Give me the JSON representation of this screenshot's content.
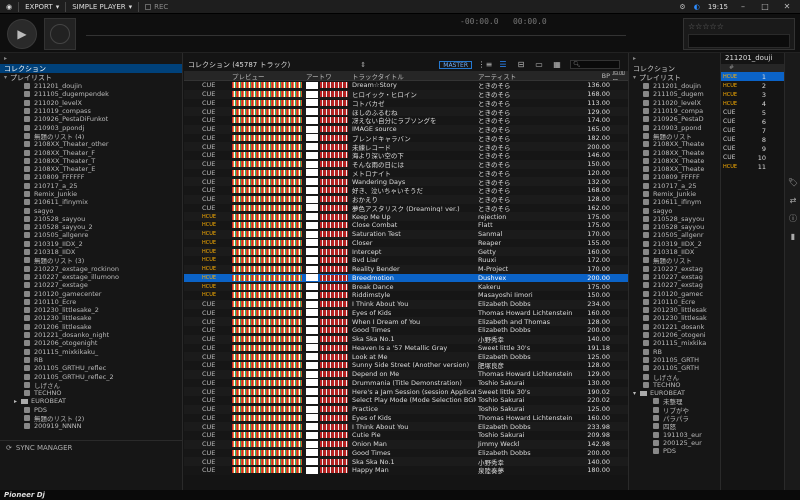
{
  "topbar": {
    "export_label": "EXPORT",
    "player_label": "SIMPLE PLAYER",
    "rec_label": "REC",
    "clock": "19:15"
  },
  "player": {
    "time_elapsed": "-00:00.0",
    "time_remain": "00:00.0",
    "stars": "☆☆☆☆☆"
  },
  "left": {
    "collection_label": "コレクション",
    "playlist_label": "プレイリスト",
    "items": [
      "211201_doujin",
      "211105_dugempendek",
      "211020_levelX",
      "211019_compass",
      "210926_PestaDiFunkot",
      "210903_ppondj",
      "無題のリスト (4)",
      "2108XX_Theater_other",
      "2108XX_Theater_F",
      "2108XX_Theater_T",
      "2108XX_Theater_E",
      "210809_FFFFFF",
      "210717_a_25",
      "Remix_Junkie",
      "210611_ifinymix",
      "sagyo",
      "210528_sayyou",
      "210528_sayyou_2",
      "210505_allgenre",
      "210319_IIDX_2",
      "210318_IIDX",
      "無題のリスト (3)",
      "210227_exstage_rockinon",
      "210227_exstage_illumono",
      "210227_exstage",
      "210120_gamecenter",
      "210110_Ecre",
      "201230_littlesake_2",
      "201230_littlesake",
      "201206_littlesake",
      "201221_dosanko_night",
      "201206_otogenight",
      "201115_mixkikaku_",
      "RB",
      "201105_GRTHU_reflec",
      "201105_GRTHU_reflec_2",
      "しげさん",
      "TECHNO",
      "EUROBEAT",
      "PDS",
      "無題のリスト (2)",
      "200919_NNNN"
    ],
    "sync_label": "SYNC MANAGER"
  },
  "main": {
    "header_title": "コレクション (45787 トラック)",
    "master_label": "MASTER",
    "columns": {
      "preview": "プレビュー",
      "artwork": "アートワ",
      "title": "トラックタイトル",
      "artist": "アーティスト",
      "bpm": "BP",
      "added": "追加日"
    }
  },
  "rows": [
    [
      "CUE",
      "Dream☆Story",
      "ときのそら",
      "136.00"
    ],
    [
      "CUE",
      "ヒロイック・ヒロイン",
      "ときのそら",
      "168.00"
    ],
    [
      "CUE",
      "コトバカゼ",
      "ときのそら",
      "113.00"
    ],
    [
      "CUE",
      "ほしのふるむね",
      "ときのそら",
      "129.00"
    ],
    [
      "CUE",
      "冴えない自分にラブソングを",
      "ときのそら",
      "174.00"
    ],
    [
      "CUE",
      "IMAGE source",
      "ときのそら",
      "165.00"
    ],
    [
      "CUE",
      "ブレンドキャラバン",
      "ときのそら",
      "182.00"
    ],
    [
      "CUE",
      "未練レコード",
      "ときのそら",
      "200.00"
    ],
    [
      "CUE",
      "海より深い空の下",
      "ときのそら",
      "146.00"
    ],
    [
      "CUE",
      "そんな雨の日には",
      "ときのそら",
      "150.00"
    ],
    [
      "CUE",
      "メトロナイト",
      "ときのそら",
      "120.00"
    ],
    [
      "CUE",
      "Wandering Days",
      "ときのそら",
      "132.00"
    ],
    [
      "CUE",
      "好き、泣いちゃいそうだ",
      "ときのそら",
      "168.00"
    ],
    [
      "CUE",
      "おかえり",
      "ときのそら",
      "128.00"
    ],
    [
      "CUE",
      "夢色アスタリスク (Dreaming! ver.)",
      "ときのそら",
      "162.00"
    ],
    [
      "HCUE",
      "Keep Me Up",
      "rejection",
      "175.00"
    ],
    [
      "HCUE",
      "Close Combat",
      "Flatt",
      "175.00"
    ],
    [
      "HCUE",
      "Saturation Test",
      "Sanmal",
      "170.00"
    ],
    [
      "HCUE",
      "Closer",
      "Reaper",
      "155.00"
    ],
    [
      "HCUE",
      "Intercept",
      "Getty",
      "160.00"
    ],
    [
      "HCUE",
      "Bvd Liar",
      "Ruuxi",
      "172.00"
    ],
    [
      "HCUE",
      "Reality Bender",
      "M-Project",
      "170.00"
    ],
    [
      "HCUE",
      "Breedmotion",
      "Dushvex",
      "200.00"
    ],
    [
      "HCUE",
      "Break Dance",
      "Kakeru",
      "175.00"
    ],
    [
      "HCUE",
      "Riddimstyle",
      "Masayoshi Iimori",
      "150.00"
    ],
    [
      "CUE",
      "I Think About You",
      "Elizabeth Dobbs",
      "234.00"
    ],
    [
      "CUE",
      "Eyes of Kids",
      "Thomas Howard Lichtenstein",
      "160.00"
    ],
    [
      "CUE",
      "When I Dream of You",
      "Elizabeth and Thomas",
      "128.00"
    ],
    [
      "CUE",
      "Good Times",
      "Elizabeth Dobbs",
      "200.00"
    ],
    [
      "CUE",
      "Ska Ska No.1",
      "小野秀幸",
      "140.00"
    ],
    [
      "CUE",
      "Heaven Is a '57 Metallic Gray",
      "Sweet little 30's",
      "191.18"
    ],
    [
      "CUE",
      "Look at Me",
      "Elizabeth Dobbs",
      "125.00"
    ],
    [
      "CUE",
      "Sunny Side Street (Another version)",
      "肥塚良彦",
      "128.00"
    ],
    [
      "CUE",
      "Depend on Me",
      "Thomas Howard Lichtenstein",
      "129.00"
    ],
    [
      "CUE",
      "Drummania (Title Demonstration)",
      "Toshio Sakurai",
      "130.00"
    ],
    [
      "CUE",
      "Here's a Jam Session (session Application",
      "Sweet little 30's",
      "190.02"
    ],
    [
      "CUE",
      "Select Play Mode (Mode Selection BGM)",
      "Toshio Sakurai",
      "220.02"
    ],
    [
      "CUE",
      "Practice",
      "Toshio Sakurai",
      "125.00"
    ],
    [
      "CUE",
      "Eyes of Kids",
      "Thomas Howard Lichtenstein",
      "160.00"
    ],
    [
      "CUE",
      "I Think About You",
      "Elizabeth Dobbs",
      "233.98"
    ],
    [
      "CUE",
      "Cutie Pie",
      "Toshio Sakurai",
      "209.98"
    ],
    [
      "CUE",
      "Onion Man",
      "Jimmy Weckl",
      "142.98"
    ],
    [
      "CUE",
      "Good Times",
      "Elizabeth Dobbs",
      "200.00"
    ],
    [
      "CUE",
      "Ska Ska No.1",
      "小野秀幸",
      "140.00"
    ],
    [
      "CUE",
      "Happy Man",
      "泉陸奏夢",
      "180.00"
    ]
  ],
  "right": {
    "collection_label": "コレクション",
    "playlist_label": "プレイリスト",
    "items": [
      "211201_doujin",
      "211105_dugem",
      "211020_levelX",
      "211019_compa",
      "210926_PestaD",
      "210903_ppond",
      "無題のリスト",
      "2108XX_Theate",
      "2108XX_Theate",
      "2108XX_Theate",
      "2108XX_Theate",
      "210809_FFFFF",
      "210717_a_25",
      "Remix_Junkie",
      "210611_ifinym",
      "sagyo",
      "210528_sayyou",
      "210528_sayyou",
      "210505_allgenr",
      "210319_IIDX_2",
      "210318_IIDX",
      "無題のリスト",
      "210227_exstag",
      "210227_exstag",
      "210227_exstag",
      "210120_gamec",
      "210110_Ecre",
      "201230_littlesak",
      "201230_littlesak",
      "201221_dosank",
      "201206_otogeni",
      "201115_mixkika",
      "RB",
      "201105_GRTH",
      "201105_GRTH",
      "しげさん",
      "TECHNO",
      "EUROBEAT"
    ],
    "euro_items": [
      "未整理",
      "リブがや",
      "パラパラ",
      "四怒",
      "191103_eur",
      "200125_eur",
      "PDS"
    ]
  },
  "sub": {
    "title": "211201_douji",
    "rows": [
      [
        "HCUE",
        "1"
      ],
      [
        "HCUE",
        "2"
      ],
      [
        "HCUE",
        "3"
      ],
      [
        "HCUE",
        "4"
      ],
      [
        "CUE",
        "5"
      ],
      [
        "CUE",
        "6"
      ],
      [
        "CUE",
        "7"
      ],
      [
        "CUE",
        "8"
      ],
      [
        "CUE",
        "9"
      ],
      [
        "CUE",
        "10"
      ],
      [
        "HCUE",
        "11"
      ]
    ]
  },
  "brand": "Pioneer Dj"
}
